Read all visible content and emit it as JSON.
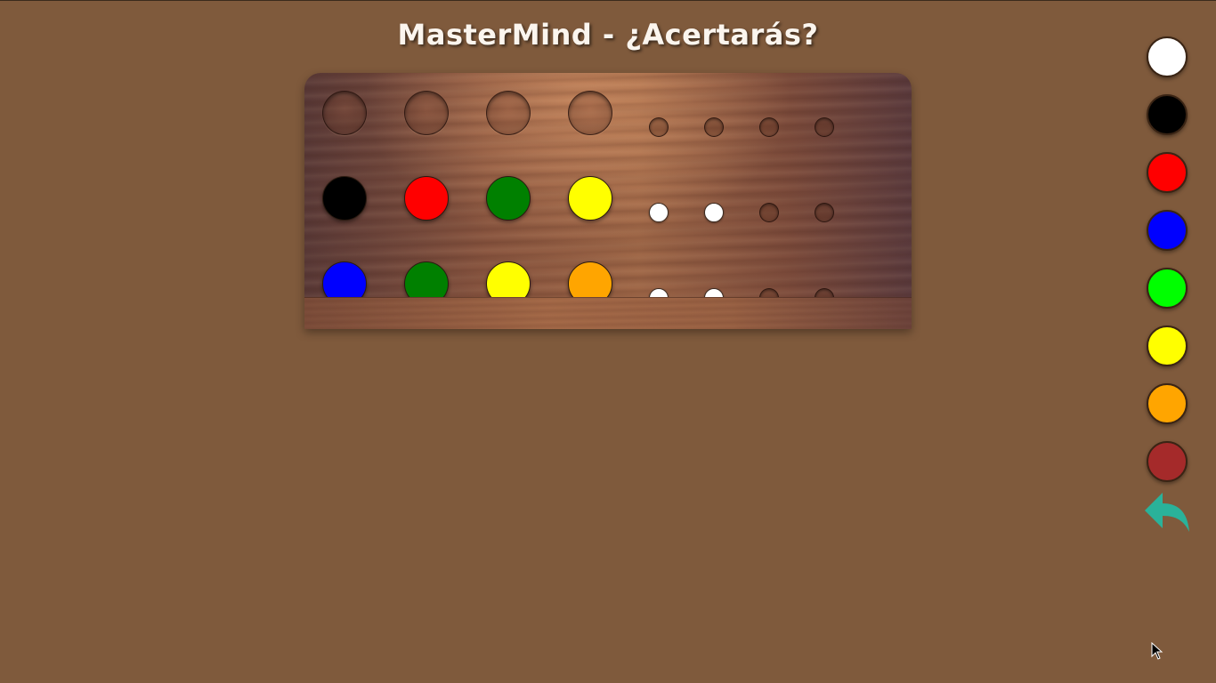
{
  "title": "MasterMind - ¿Acertarás?",
  "colors": {
    "background": "#7f5a3c",
    "undo_arrow": "#2ab29a"
  },
  "board": {
    "rows": [
      {
        "pegs": [
          null,
          null,
          null,
          null
        ],
        "hints": [
          null,
          null,
          null,
          null
        ]
      },
      {
        "pegs": [
          "#000000",
          "#ff0000",
          "#008000",
          "#ffff00"
        ],
        "hints": [
          "#ffffff",
          "#ffffff",
          null,
          null
        ]
      },
      {
        "pegs": [
          "#0000ff",
          "#008000",
          "#ffff00",
          "#ffa500"
        ],
        "hints": [
          "#ffffff",
          "#ffffff",
          null,
          null
        ]
      }
    ]
  },
  "palette": [
    {
      "name": "white",
      "color": "#ffffff"
    },
    {
      "name": "black",
      "color": "#000000"
    },
    {
      "name": "red",
      "color": "#ff0000"
    },
    {
      "name": "blue",
      "color": "#0000ff"
    },
    {
      "name": "green",
      "color": "#00ff00"
    },
    {
      "name": "yellow",
      "color": "#ffff00"
    },
    {
      "name": "orange",
      "color": "#ffa500"
    },
    {
      "name": "brown",
      "color": "#a52a2a"
    }
  ],
  "undo_icon": "undo-arrow-icon"
}
